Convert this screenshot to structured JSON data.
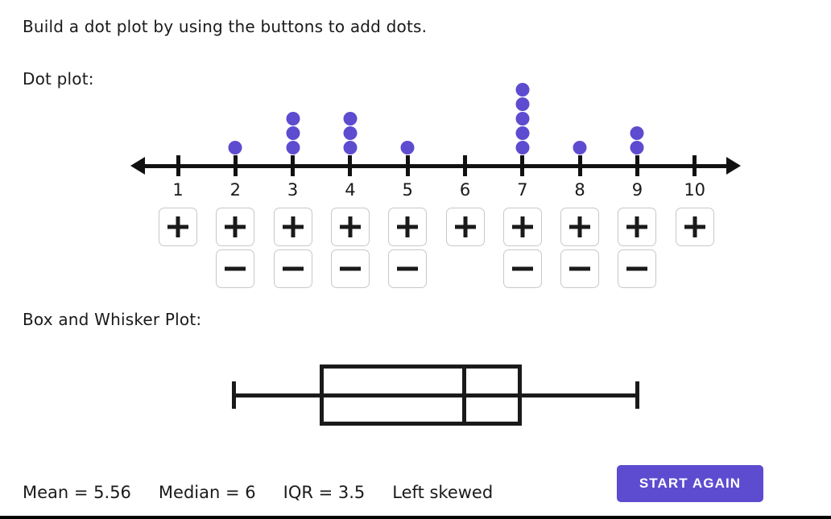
{
  "prompt": "Build a dot plot by using the buttons to add dots.",
  "sections": {
    "dotplot_label": "Dot plot:",
    "boxplot_label": "Box and Whisker Plot:"
  },
  "colors": {
    "dot": "#5d4bd0",
    "accent_button": "#5d4bd0",
    "axis": "#111111",
    "button_border": "#c8c8c8",
    "text": "#1a1a1a"
  },
  "controls": {
    "add_label": "+",
    "remove_label": "−",
    "start_again_label": "START AGAIN"
  },
  "stats": [
    {
      "name": "mean",
      "text": "Mean = 5.56"
    },
    {
      "name": "median",
      "text": "Median = 6"
    },
    {
      "name": "iqr",
      "text": "IQR = 3.5"
    },
    {
      "name": "skew",
      "text": "Left skewed"
    }
  ],
  "chart_data": {
    "type": "bar",
    "subtype": "dotplot",
    "title": "Dot plot:",
    "xlabel": "",
    "ylabel": "",
    "categories": [
      1,
      2,
      3,
      4,
      5,
      6,
      7,
      8,
      9,
      10
    ],
    "tick_labels": [
      "1",
      "2",
      "3",
      "4",
      "5",
      "6",
      "7",
      "8",
      "9",
      "10"
    ],
    "values": [
      0,
      1,
      3,
      3,
      1,
      0,
      5,
      1,
      2,
      0
    ],
    "xlim": [
      1,
      10
    ],
    "grid": false,
    "legend": "none",
    "axis_arrows": [
      "left",
      "right"
    ],
    "boxplot": {
      "type": "boxplot",
      "title": "Box and Whisker Plot:",
      "min": 2,
      "q1": 3.5,
      "median": 6,
      "q3": 7,
      "max": 9,
      "iqr": 3.5,
      "mean": 5.56,
      "skew": "Left skewed"
    }
  }
}
